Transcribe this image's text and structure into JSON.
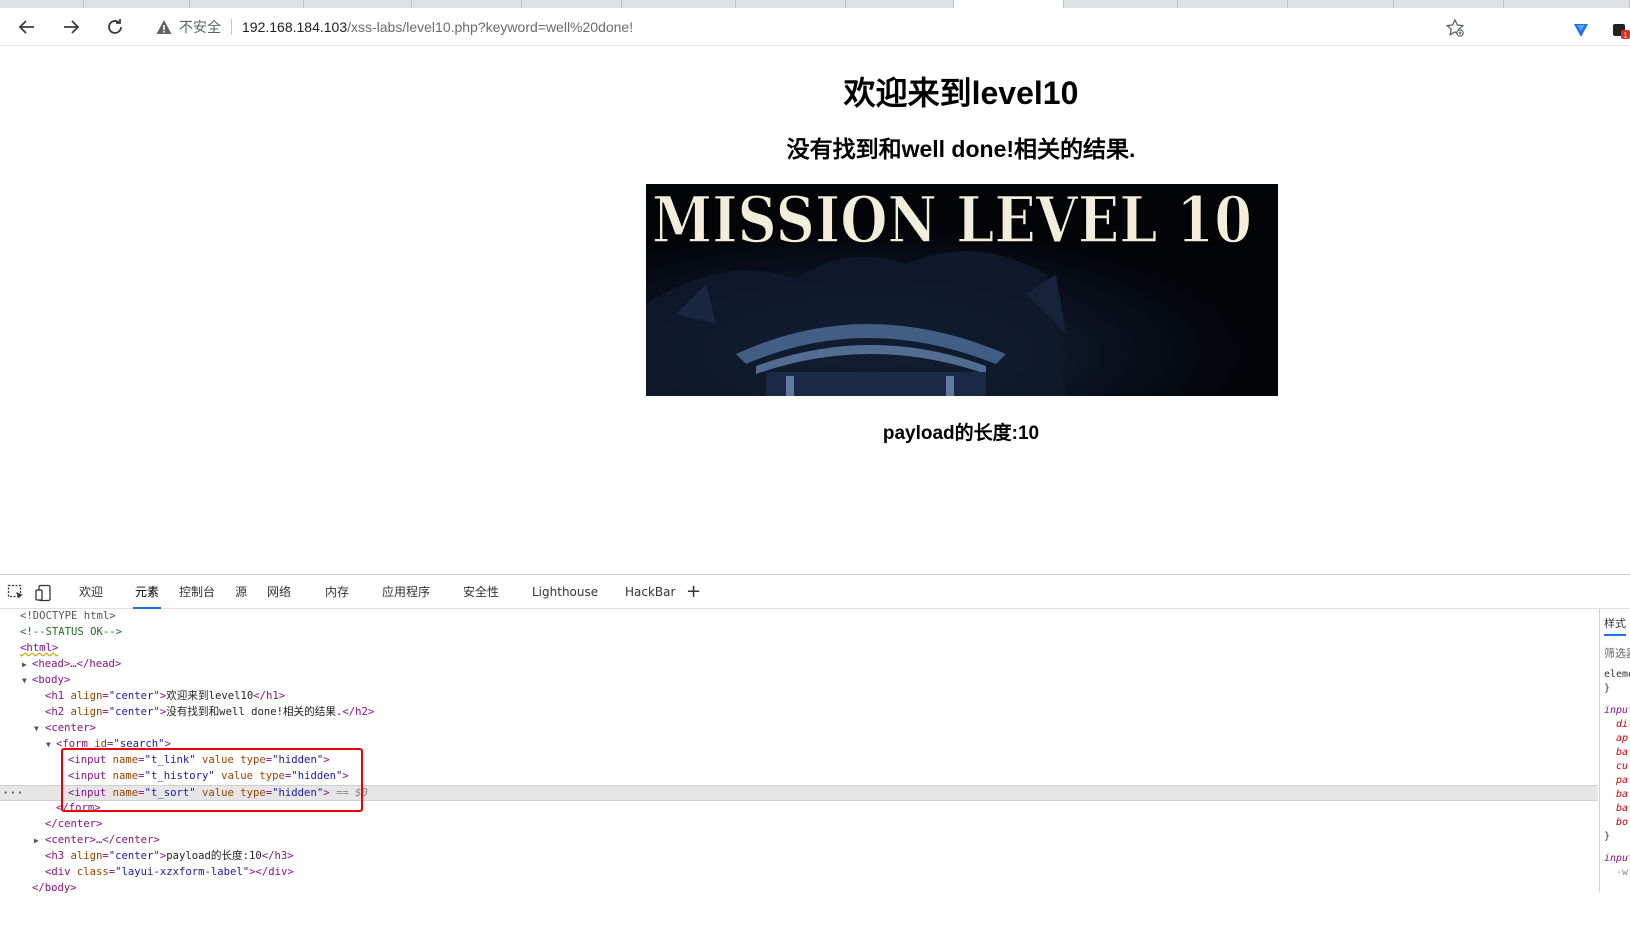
{
  "browser": {
    "security_label": "不安全",
    "url_host": "192.168.184.103",
    "url_path": "/xss-labs/level10.php?keyword=well%20done!",
    "back_icon": "arrow-left-icon",
    "forward_icon": "arrow-right-icon",
    "reload_icon": "reload-icon"
  },
  "page": {
    "h1": "欢迎来到level10",
    "h2": "没有找到和well done!相关的结果.",
    "banner_text": "MISSION LEVEL 10",
    "h3": "payload的长度:10"
  },
  "devtools": {
    "tabs": [
      "欢迎",
      "元素",
      "控制台",
      "源",
      "网络",
      "内存",
      "应用程序",
      "安全性",
      "Lighthouse",
      "HackBar"
    ],
    "active_tab": "元素",
    "styles_tab": "样式",
    "filter_placeholder": "筛选器",
    "dom": {
      "doctype": "<!DOCTYPE html>",
      "comment": "<!--STATUS OK-->",
      "html_open": "<html>",
      "head": "<head>…</head>",
      "body_open": "<body>",
      "h1_tag_open": "<h1 ",
      "h1_attr": "align",
      "h1_val": "\"center\"",
      "h1_text": "欢迎来到level10",
      "h1_close": "</h1>",
      "h2_tag_open": "<h2 ",
      "h2_attr": "align",
      "h2_val": "\"center\"",
      "h2_text": "没有找到和well done!相关的结果.",
      "h2_close": "</h2>",
      "center_open": "<center>",
      "form_open_tag": "<form ",
      "form_attr": "id",
      "form_val": "\"search\"",
      "input1_name": "\"t_link\"",
      "input2_name": "\"t_history\"",
      "input3_name": "\"t_sort\"",
      "hidden": "\"hidden\"",
      "eq_dollar": "== $0",
      "form_close": "</form>",
      "center_close": "</center>",
      "center_collapsed": "<center>…</center>",
      "h3_tag_open": "<h3 ",
      "h3_attr": "align",
      "h3_val": "\"center\"",
      "h3_text": "payload的长度:10",
      "h3_close": "</h3>",
      "div_tag_open": "<div ",
      "div_attr": "class",
      "div_val": "\"layui-xzxform-label\"",
      "div_close": "</div>",
      "body_close": "</body>"
    },
    "styles_lines": [
      "eleme",
      "}",
      "input",
      "di",
      "ap",
      "ba",
      "cu",
      "pa",
      "ba",
      "ba",
      "bo",
      "}",
      "input",
      "-w"
    ]
  }
}
